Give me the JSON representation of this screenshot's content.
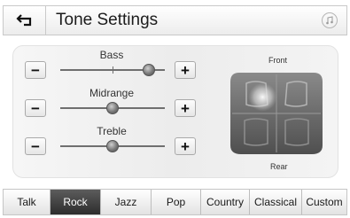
{
  "header": {
    "title": "Tone Settings",
    "back_icon": "back-arrow-icon",
    "right_icon": "music-note-icon"
  },
  "equalizer": [
    {
      "label": "Bass",
      "minus": "−",
      "plus": "+",
      "level": 0.85
    },
    {
      "label": "Midrange",
      "minus": "−",
      "plus": "+",
      "level": 0.5
    },
    {
      "label": "Treble",
      "minus": "−",
      "plus": "+",
      "level": 0.5
    }
  ],
  "fader": {
    "front_label": "Front",
    "rear_label": "Rear",
    "balance_x": 0.35,
    "fade_y": 0.3
  },
  "tabs": [
    {
      "label": "Talk",
      "active": false
    },
    {
      "label": "Rock",
      "active": true
    },
    {
      "label": "Jazz",
      "active": false
    },
    {
      "label": "Pop",
      "active": false
    },
    {
      "label": "Country",
      "active": false
    },
    {
      "label": "Classical",
      "active": false
    },
    {
      "label": "Custom",
      "active": false
    }
  ],
  "colors": {
    "active_tab": "#3a3a3a",
    "seat_highlight": "#ffffff"
  }
}
